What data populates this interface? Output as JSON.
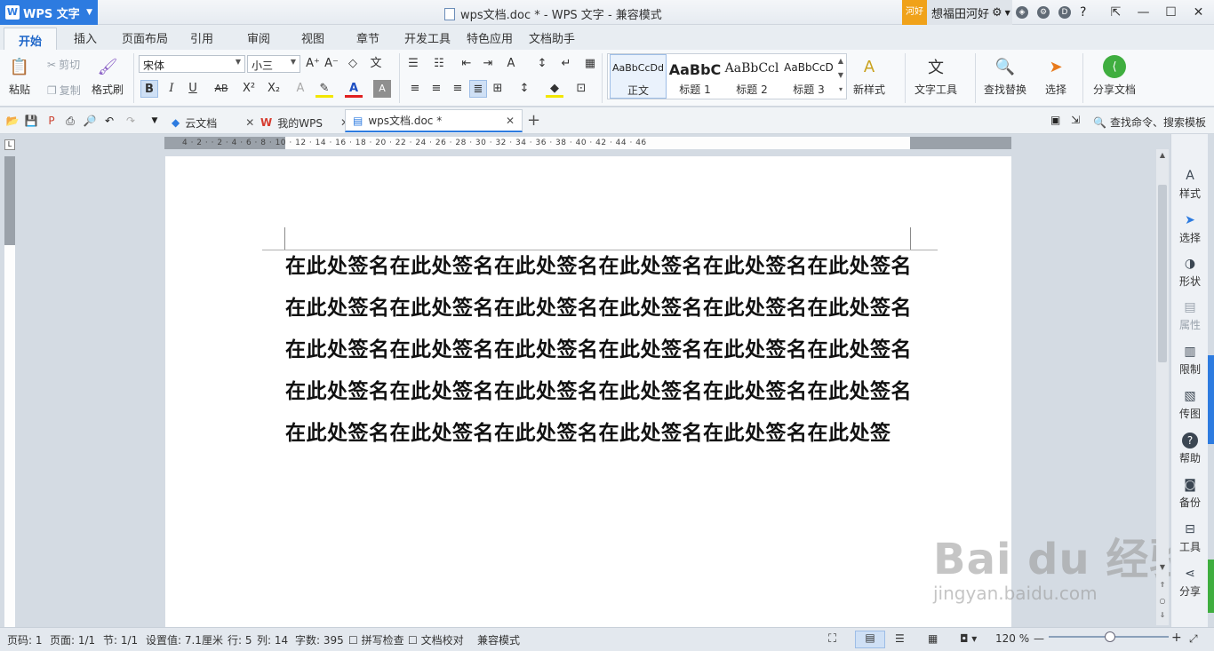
{
  "app": {
    "name": "WPS 文字",
    "doc_title": "wps文档.doc * - WPS 文字 - 兼容模式"
  },
  "user": {
    "badge": "河好",
    "name": "想福田河好"
  },
  "menu": [
    "开始",
    "插入",
    "页面布局",
    "引用",
    "审阅",
    "视图",
    "章节",
    "开发工具",
    "特色应用",
    "文档助手"
  ],
  "ribbon": {
    "paste": "粘贴",
    "cut": "剪切",
    "copy": "复制",
    "format_painter": "格式刷",
    "font_name": "宋体",
    "font_size": "小三",
    "bold": "B",
    "italic": "I",
    "underline": "U",
    "strike": "AB",
    "superscript": "X²",
    "subscript": "X₂",
    "font_color": "A",
    "styles": [
      {
        "sample": "AaBbCcDd",
        "name": "正文"
      },
      {
        "sample": "AaBbC",
        "name": "标题 1"
      },
      {
        "sample": "AaBbCcl",
        "name": "标题 2"
      },
      {
        "sample": "AaBbCcD",
        "name": "标题 3"
      }
    ],
    "new_style": "新样式",
    "text_tools": "文字工具",
    "find_replace": "查找替换",
    "select": "选择",
    "share_doc": "分享文档"
  },
  "tabs": [
    {
      "label": "云文档"
    },
    {
      "label": "我的WPS"
    },
    {
      "label": "wps文档.doc *"
    }
  ],
  "search_cmd": "查找命令、搜索模板",
  "ruler_numbers": "4  ·  2  ·  ·  2  ·  4  ·  6  ·  8  ·  10  ·  12  ·  14  ·  16  ·  18  ·  20  ·  22  ·  24  ·  26  ·  28  ·  30  ·  32  ·  34  ·  36  ·  38  ·  40  ·  42  ·  44  ·  46",
  "body_text": "在此处签名在此处签名在此处签名在此处签名在此处签名在此处签名在此处签名在此处签名在此处签名在此处签名在此处签名在此处签名在此处签名在此处签名在此处签名在此处签名在此处签名在此处签名在此处签名在此处签名在此处签名在此处签名在此处签名在此处签名在此处签名在此处签名在此处签名在此处签名在此处签名在此处签",
  "sidebar": [
    {
      "label": "样式",
      "icon": "style-icon"
    },
    {
      "label": "选择",
      "icon": "select-icon"
    },
    {
      "label": "形状",
      "icon": "shape-icon"
    },
    {
      "label": "属性",
      "icon": "property-icon"
    },
    {
      "label": "限制",
      "icon": "restrict-icon"
    },
    {
      "label": "传图",
      "icon": "upload-image-icon"
    },
    {
      "label": "帮助",
      "icon": "help-icon"
    },
    {
      "label": "备份",
      "icon": "backup-icon"
    },
    {
      "label": "工具",
      "icon": "tools-icon"
    },
    {
      "label": "分享",
      "icon": "share-icon"
    }
  ],
  "status": {
    "page_code": "页码: 1",
    "page": "页面: 1/1",
    "section": "节: 1/1",
    "setting": "设置值: 7.1厘米",
    "row": "行: 5",
    "col": "列: 14",
    "word_count": "字数: 395",
    "spell": "拼写检查",
    "proofread": "文档校对",
    "compat": "兼容模式",
    "zoom": "120 %"
  },
  "watermark": {
    "brand": "Bai du 经验",
    "url": "jingyan.baidu.com"
  }
}
